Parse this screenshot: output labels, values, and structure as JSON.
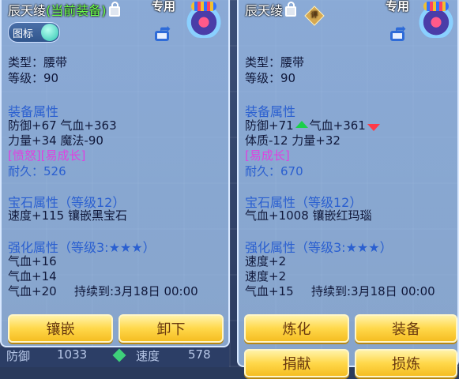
{
  "left": {
    "name": "辰天绫",
    "equipped_tag": "(当前装备)",
    "special": "专用",
    "icon_toggle_label": "图标",
    "type": "类型：腰带",
    "level": "等级：90",
    "equip_attr_header": "装备属性",
    "attr1": "防御+67 气血+363",
    "attr2": "力量+34 魔法-90",
    "special_tags": "[愤怒][易成长]",
    "durability": "耐久：526",
    "gem_header": "宝石属性（等级12）",
    "gem_line": "速度+115 镶嵌黑宝石",
    "enh_header": "强化属性（等级3:★★★）",
    "enh1": "气血+16",
    "enh2": "气血+14",
    "enh3": "气血+20",
    "enh3_duration": "持续到:3月18日 00:00",
    "btn1": "镶嵌",
    "btn2": "卸下"
  },
  "right": {
    "name": "辰天绫",
    "badge": "评",
    "special": "专用",
    "type": "类型：腰带",
    "level": "等级：90",
    "equip_attr_header": "装备属性",
    "attr1a": "防御+71",
    "attr1b": "气血+361",
    "attr2": "体质-12 力量+32",
    "special_tags": "[易成长]",
    "durability": "耐久：670",
    "gem_header": "宝石属性（等级12）",
    "gem_line": "气血+1008 镶嵌红玛瑙",
    "enh_header": "强化属性（等级3:★★★）",
    "enh1": "速度+2",
    "enh2": "速度+2",
    "enh3": "气血+15",
    "enh3_duration": "持续到:3月18日 00:00",
    "btn1": "炼化",
    "btn2": "装备",
    "btn3": "捐献",
    "btn4": "损炼"
  },
  "bottom": {
    "stat1_label": "防御",
    "stat1_value": "1033",
    "stat2_label": "速度",
    "stat2_value": "578"
  }
}
